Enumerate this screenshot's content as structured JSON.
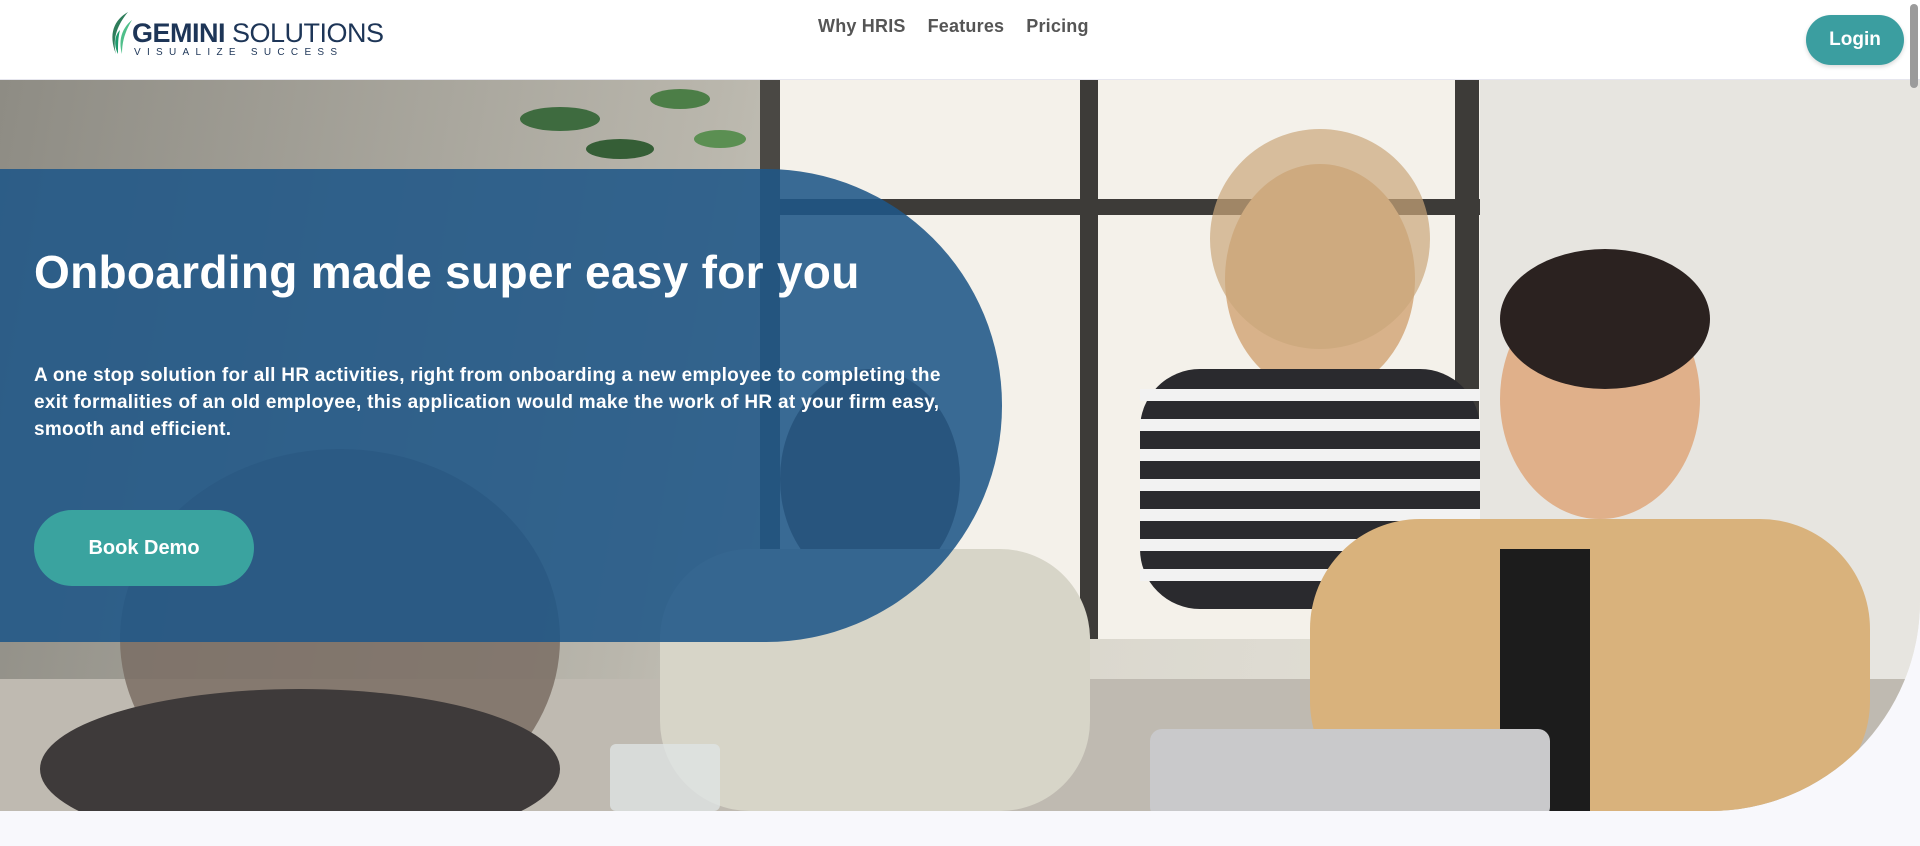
{
  "header": {
    "logo": {
      "brand_bold": "GEMINI",
      "brand_light": " SOLUTIONS",
      "tagline": "VISUALIZE SUCCESS"
    },
    "nav": [
      {
        "label": "Why HRIS"
      },
      {
        "label": "Features"
      },
      {
        "label": "Pricing"
      }
    ],
    "login_label": "Login"
  },
  "hero": {
    "title": "Onboarding made super easy for you",
    "description": "A one stop solution for all HR activities, right from onboarding a new employee to completing the exit formalities of an old employee, this application would make the work of HR at your firm easy, smooth and efficient.",
    "cta_label": "Book Demo"
  },
  "colors": {
    "accent_teal": "#3b9ea0",
    "panel_blue": "#1f5687",
    "brand_navy": "#1d3557"
  }
}
